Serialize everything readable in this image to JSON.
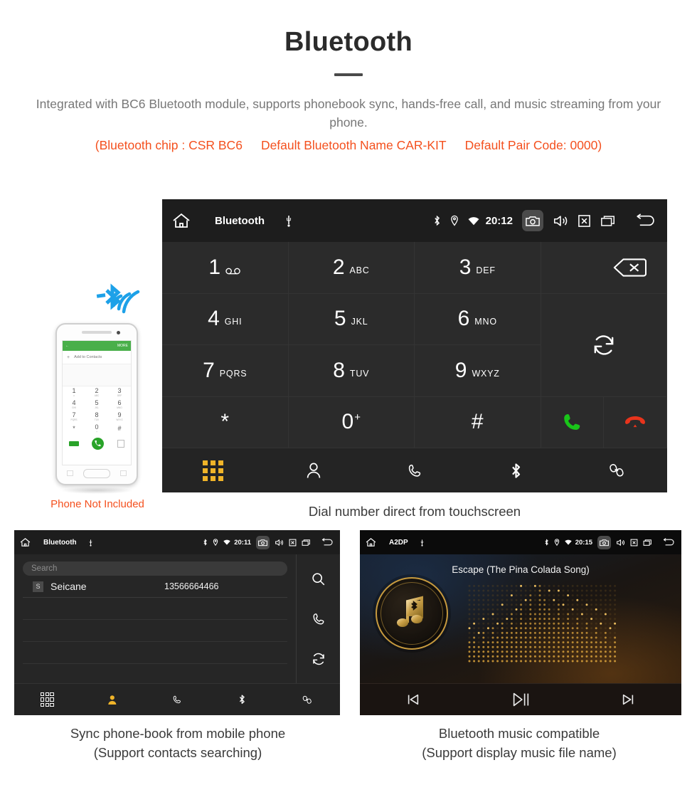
{
  "header": {
    "title": "Bluetooth",
    "intro": "Integrated with BC6 Bluetooth module, supports phonebook sync, hands-free call, and music streaming from your phone.",
    "spec_chip": "(Bluetooth chip : CSR BC6",
    "spec_name": "Default Bluetooth Name CAR-KIT",
    "spec_pair": "Default Pair Code: 0000)",
    "accent_color": "#f4501e",
    "text_color": "#777777"
  },
  "dialer": {
    "statusbar": {
      "home_icon": "home-icon",
      "title": "Bluetooth",
      "usb_icon": "usb-icon",
      "bluetooth_icon": "bluetooth-icon",
      "location_icon": "location-icon",
      "wifi_icon": "wifi-icon",
      "time": "20:12",
      "camera_icon": "camera-icon",
      "volume_icon": "volume-icon",
      "close_icon": "close-box-icon",
      "recents_icon": "recents-icon",
      "back_icon": "back-icon"
    },
    "keys": [
      {
        "digit": "1",
        "letters": "",
        "icon": "voicemail-icon"
      },
      {
        "digit": "2",
        "letters": "ABC",
        "icon": ""
      },
      {
        "digit": "3",
        "letters": "DEF",
        "icon": ""
      },
      {
        "digit": "4",
        "letters": "GHI",
        "icon": ""
      },
      {
        "digit": "5",
        "letters": "JKL",
        "icon": ""
      },
      {
        "digit": "6",
        "letters": "MNO",
        "icon": ""
      },
      {
        "digit": "7",
        "letters": "PQRS",
        "icon": ""
      },
      {
        "digit": "8",
        "letters": "TUV",
        "icon": ""
      },
      {
        "digit": "9",
        "letters": "WXYZ",
        "icon": ""
      },
      {
        "digit": "*",
        "letters": "",
        "icon": ""
      },
      {
        "digit": "0",
        "letters": "",
        "icon": "",
        "sup": "+"
      },
      {
        "digit": "#",
        "letters": "",
        "icon": ""
      }
    ],
    "number_field_value": "",
    "backspace_icon": "backspace-icon",
    "sync_icon": "sync-icon",
    "call_icon": "call-icon",
    "hangup_icon": "hangup-icon",
    "call_color": "#19c519",
    "hangup_color": "#e8341c",
    "nav": [
      {
        "name": "keypad",
        "icon": "keypad-icon",
        "active": true
      },
      {
        "name": "contacts",
        "icon": "contact-icon",
        "active": false
      },
      {
        "name": "call-log",
        "icon": "phone-icon",
        "active": false
      },
      {
        "name": "bluetooth",
        "icon": "bluetooth-icon",
        "active": false
      },
      {
        "name": "link",
        "icon": "link-icon",
        "active": false
      }
    ],
    "active_color": "#f0b429",
    "caption": "Dial number direct from touchscreen"
  },
  "phone_mockup": {
    "bt_signal_icon": "bluetooth-signal-icon",
    "bt_color": "#1da1e8",
    "app_back_icon": "back-arrow-icon",
    "app_more_label": "MORE",
    "add_contact_label": "Add to Contacts",
    "keys": [
      {
        "digit": "1",
        "letters": "∞"
      },
      {
        "digit": "2",
        "letters": "ABC"
      },
      {
        "digit": "3",
        "letters": "DEF"
      },
      {
        "digit": "4",
        "letters": "GHI"
      },
      {
        "digit": "5",
        "letters": "JKL"
      },
      {
        "digit": "6",
        "letters": "MNO"
      },
      {
        "digit": "7",
        "letters": "PQRS"
      },
      {
        "digit": "8",
        "letters": "TUV"
      },
      {
        "digit": "9",
        "letters": "WXYZ"
      },
      {
        "digit": "*",
        "letters": ""
      },
      {
        "digit": "0",
        "letters": "+"
      },
      {
        "digit": "#",
        "letters": ""
      }
    ],
    "caption": "Phone Not Included",
    "caption_color": "#f4501e"
  },
  "phonebook": {
    "statusbar": {
      "home_icon": "home-icon",
      "title": "Bluetooth",
      "usb_icon": "usb-icon",
      "time": "20:11",
      "camera_icon": "camera-icon",
      "volume_icon": "volume-icon",
      "close_icon": "close-box-icon",
      "recents_icon": "recents-icon",
      "back_icon": "back-icon"
    },
    "search_placeholder": "Search",
    "search_value": "",
    "contacts": [
      {
        "initial": "S",
        "name": "Seicane",
        "number": "13566664466"
      }
    ],
    "side_actions": [
      {
        "name": "search",
        "icon": "search-icon"
      },
      {
        "name": "call",
        "icon": "phone-icon"
      },
      {
        "name": "sync",
        "icon": "sync-icon"
      }
    ],
    "nav": [
      {
        "name": "keypad",
        "icon": "keypad-icon",
        "active": false
      },
      {
        "name": "contacts",
        "icon": "contact-icon",
        "active": true
      },
      {
        "name": "call-log",
        "icon": "phone-icon",
        "active": false
      },
      {
        "name": "bluetooth",
        "icon": "bluetooth-icon",
        "active": false
      },
      {
        "name": "link",
        "icon": "link-icon",
        "active": false
      }
    ],
    "caption_line1": "Sync phone-book from mobile phone",
    "caption_line2": "(Support contacts searching)"
  },
  "music": {
    "statusbar": {
      "home_icon": "home-icon",
      "title": "A2DP",
      "usb_icon": "usb-icon",
      "time": "20:15",
      "camera_icon": "camera-icon",
      "volume_icon": "volume-icon",
      "close_icon": "close-box-icon",
      "recents_icon": "recents-icon",
      "back_icon": "back-icon"
    },
    "song_title": "Escape (The Pina Colada Song)",
    "album_icon": "music-note-bluetooth-icon",
    "equalizer_icon": "equalizer-dots",
    "accent_color": "#c79a3e",
    "controls": [
      {
        "name": "previous",
        "icon": "previous-icon"
      },
      {
        "name": "play-pause",
        "icon": "play-pause-icon"
      },
      {
        "name": "next",
        "icon": "next-icon"
      }
    ],
    "caption_line1": "Bluetooth music compatible",
    "caption_line2": "(Support display music file name)"
  }
}
